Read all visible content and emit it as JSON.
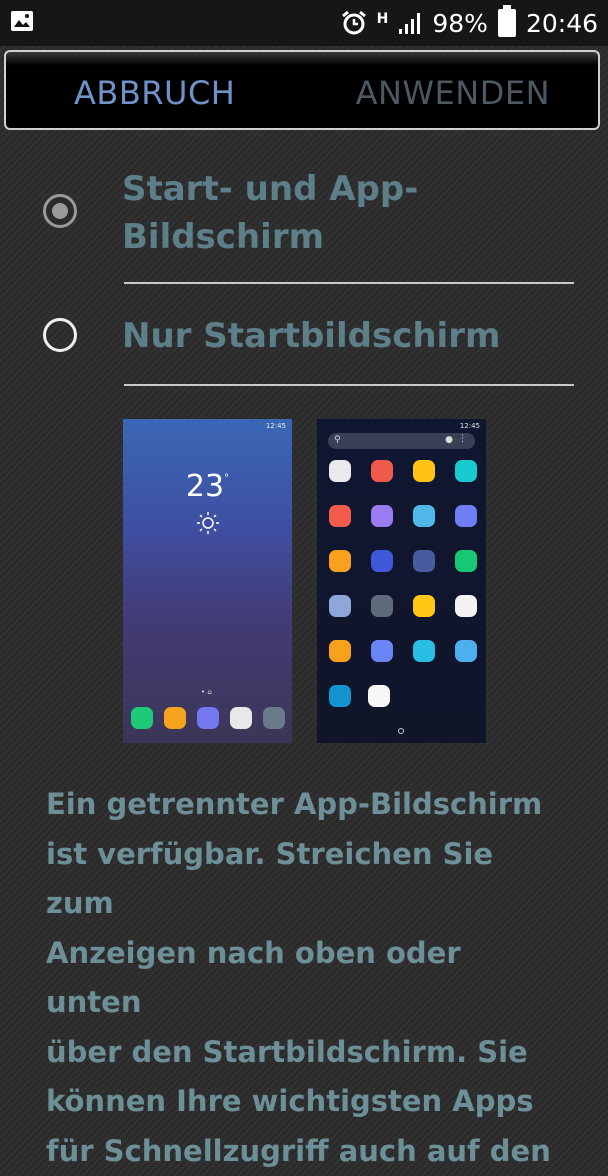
{
  "status_bar": {
    "left_icon": "image-notification-icon",
    "alarm_icon": "alarm-clock-icon",
    "network_label": "H",
    "battery": "98%",
    "time": "20:46"
  },
  "action_bar": {
    "cancel_label": "ABBRUCH",
    "apply_label": "ANWENDEN"
  },
  "options": [
    {
      "label": "Start- und App-\nBildschirm",
      "selected": true
    },
    {
      "label": "Nur Startbildschirm",
      "selected": false
    }
  ],
  "preview_home": {
    "status_time": "12:45",
    "temperature": "23",
    "degree": "°",
    "dock_colors": [
      "#1ec97a",
      "#f7a21c",
      "#7478f0",
      "#e8e8e8",
      "#6a7a88"
    ]
  },
  "preview_apps": {
    "status_time": "12:45",
    "grid_colors": [
      [
        "#e9e9ee",
        "#f05a4a",
        "#ffc313",
        "#19cbd0"
      ],
      [
        "#f45c4e",
        "#9a7cf2",
        "#4fb7ea",
        "#6f7ef4"
      ],
      [
        "#f9a11d",
        "#3d58d8",
        "#4a5a9e",
        "#17c873"
      ],
      [
        "#8fa6d8",
        "#5e6b7a",
        "#ffc614",
        "#f2f2f2"
      ],
      [
        "#f9a11d",
        "#6a86f4",
        "#29bfe4",
        "#4cb0ee"
      ],
      [
        "#1393d0",
        "#f7f7f7"
      ]
    ]
  },
  "description": "Ein getrennter App-Bildschirm\nist verfügbar. Streichen Sie zum\nAnzeigen nach oben oder unten\nüber den Startbildschirm. Sie\nkönnen Ihre wichtigsten Apps\nfür Schnellzugriff auch auf den"
}
